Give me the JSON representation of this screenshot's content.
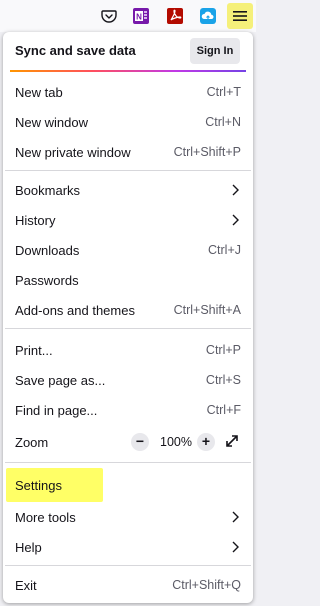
{
  "toolbar": {
    "icons": [
      "pocket-icon",
      "onenote-icon",
      "pdf-icon",
      "cloud-upload-icon",
      "hamburger-menu-icon"
    ],
    "onenote_letter": "N"
  },
  "sync": {
    "title": "Sync and save data",
    "signin_label": "Sign In"
  },
  "menu": {
    "new_tab": {
      "label": "New tab",
      "shortcut": "Ctrl+T"
    },
    "new_window": {
      "label": "New window",
      "shortcut": "Ctrl+N"
    },
    "new_private_window": {
      "label": "New private window",
      "shortcut": "Ctrl+Shift+P"
    },
    "bookmarks": {
      "label": "Bookmarks"
    },
    "history": {
      "label": "History"
    },
    "downloads": {
      "label": "Downloads",
      "shortcut": "Ctrl+J"
    },
    "passwords": {
      "label": "Passwords"
    },
    "addons": {
      "label": "Add-ons and themes",
      "shortcut": "Ctrl+Shift+A"
    },
    "print": {
      "label": "Print...",
      "shortcut": "Ctrl+P"
    },
    "save_page": {
      "label": "Save page as...",
      "shortcut": "Ctrl+S"
    },
    "find": {
      "label": "Find in page...",
      "shortcut": "Ctrl+F"
    },
    "zoom": {
      "label": "Zoom",
      "minus": "−",
      "value": "100%",
      "plus": "+"
    },
    "settings": {
      "label": "Settings"
    },
    "more_tools": {
      "label": "More tools"
    },
    "help": {
      "label": "Help"
    },
    "exit": {
      "label": "Exit",
      "shortcut": "Ctrl+Shift+Q"
    }
  },
  "colors": {
    "highlight": "#ffff66",
    "menu_button_highlight": "#f5f07a"
  }
}
